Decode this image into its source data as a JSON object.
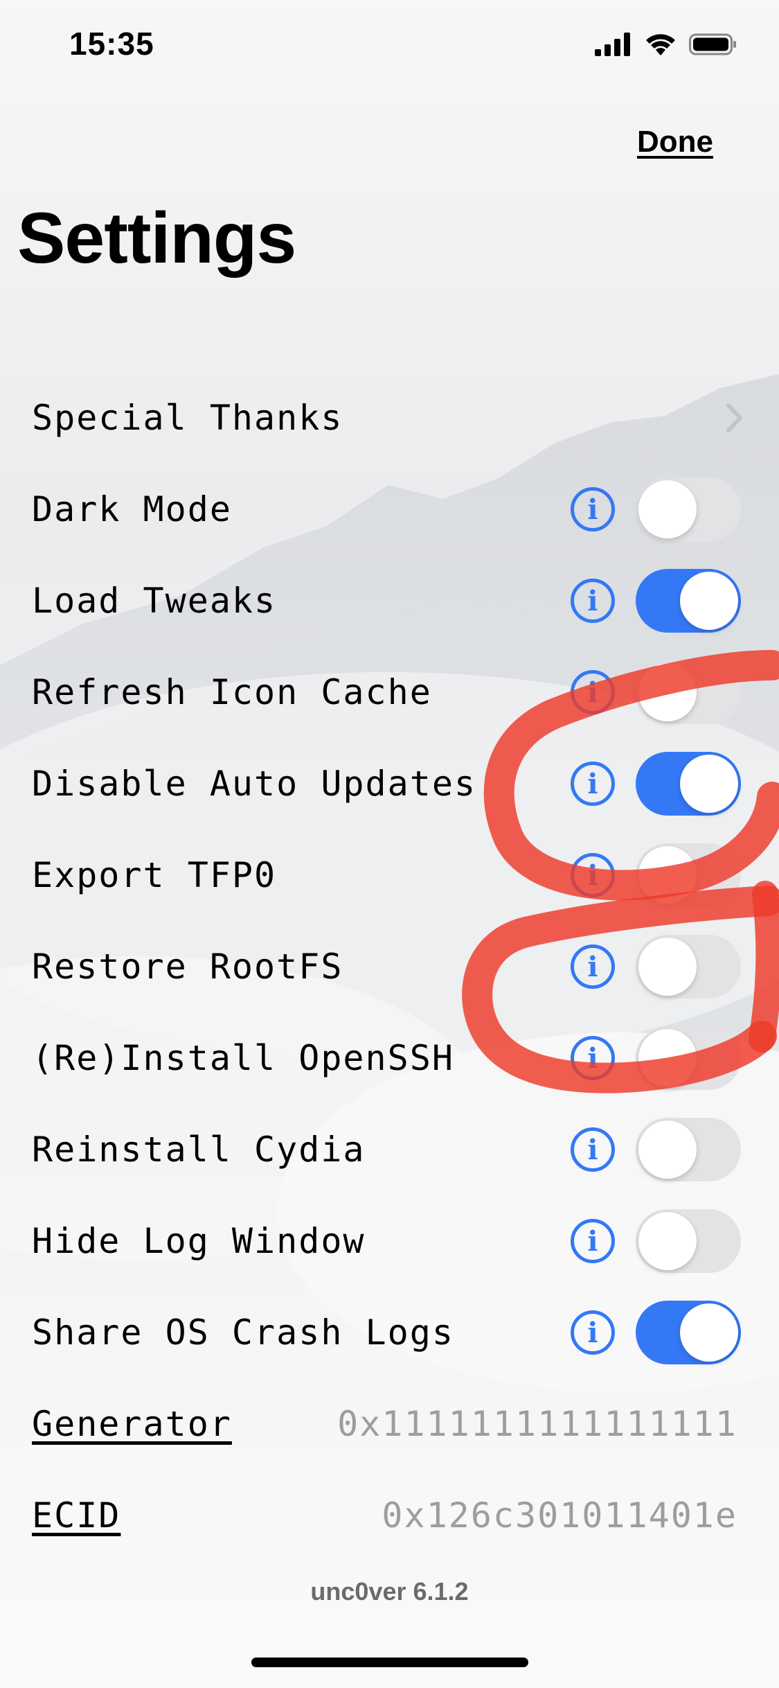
{
  "status_bar": {
    "time": "15:35"
  },
  "nav": {
    "done_label": "Done"
  },
  "page": {
    "title": "Settings"
  },
  "rows": [
    {
      "label": "Special Thanks",
      "kind": "link"
    },
    {
      "label": "Dark Mode",
      "kind": "toggle",
      "on": false
    },
    {
      "label": "Load Tweaks",
      "kind": "toggle",
      "on": true
    },
    {
      "label": "Refresh Icon Cache",
      "kind": "toggle",
      "on": false
    },
    {
      "label": "Disable Auto Updates",
      "kind": "toggle",
      "on": true
    },
    {
      "label": "Export TFP0",
      "kind": "toggle",
      "on": false
    },
    {
      "label": "Restore RootFS",
      "kind": "toggle",
      "on": false
    },
    {
      "label": "(Re)Install OpenSSH",
      "kind": "toggle",
      "on": false
    },
    {
      "label": "Reinstall Cydia",
      "kind": "toggle",
      "on": false
    },
    {
      "label": "Hide Log Window",
      "kind": "toggle",
      "on": false
    },
    {
      "label": "Share OS Crash Logs",
      "kind": "toggle",
      "on": true
    },
    {
      "label": "Generator",
      "kind": "value",
      "value": "0x1111111111111111"
    },
    {
      "label": "ECID",
      "kind": "value",
      "value": "0x126c301011401e"
    }
  ],
  "info_icon": {
    "glyph": "i"
  },
  "footer": {
    "version": "unc0ver 6.1.2"
  },
  "colors": {
    "accent": "#3478f6",
    "toggle_off": "#e3e3e6",
    "value_text": "#9d9d9f",
    "scribble": "#ee3a2a"
  },
  "icons": [
    "cellular-signal-icon",
    "wifi-icon",
    "battery-icon",
    "chevron-right-icon",
    "info-icon"
  ]
}
